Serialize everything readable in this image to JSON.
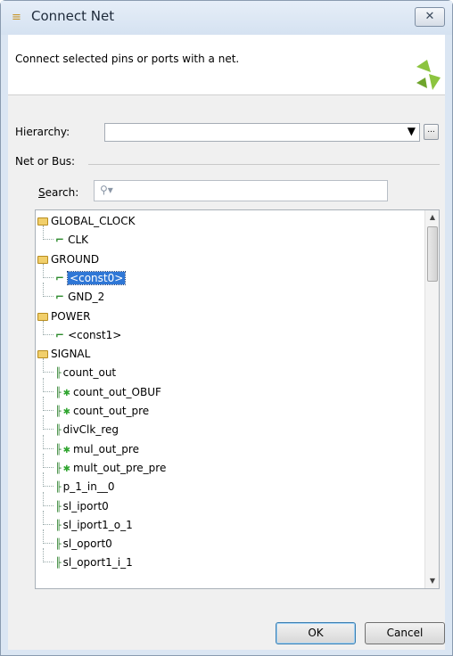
{
  "window": {
    "title": "Connect Net",
    "close_glyph": "✕"
  },
  "header": {
    "description": "Connect selected pins or ports with a net."
  },
  "hierarchy": {
    "label": "Hierarchy:",
    "value": "",
    "more_label": "..."
  },
  "net_or_bus": {
    "label": "Net or Bus:"
  },
  "search": {
    "label_prefix": "S",
    "label_rest": "earch:",
    "value": ""
  },
  "tree": [
    {
      "kind": "group",
      "label": "GLOBAL_CLOCK"
    },
    {
      "kind": "net",
      "label": "CLK"
    },
    {
      "kind": "group",
      "label": "GROUND"
    },
    {
      "kind": "net",
      "label": "<const0>",
      "selected": true
    },
    {
      "kind": "net",
      "label": "GND_2"
    },
    {
      "kind": "group",
      "label": "POWER"
    },
    {
      "kind": "net",
      "label": "<const1>"
    },
    {
      "kind": "group",
      "label": "SIGNAL"
    },
    {
      "kind": "bus",
      "label": "count_out"
    },
    {
      "kind": "bus",
      "label": "count_out_OBUF",
      "star": true
    },
    {
      "kind": "bus",
      "label": "count_out_pre",
      "star": true
    },
    {
      "kind": "bus",
      "label": "divClk_reg"
    },
    {
      "kind": "bus",
      "label": "mul_out_pre",
      "star": true
    },
    {
      "kind": "bus",
      "label": "mult_out_pre_pre",
      "star": true
    },
    {
      "kind": "bus",
      "label": "p_1_in__0"
    },
    {
      "kind": "bus",
      "label": "sl_iport0"
    },
    {
      "kind": "bus",
      "label": "sl_iport1_o_1"
    },
    {
      "kind": "bus",
      "label": "sl_oport0"
    },
    {
      "kind": "bus",
      "label": "sl_oport1_i_1"
    }
  ],
  "buttons": {
    "ok": "OK",
    "cancel": "Cancel"
  },
  "colors": {
    "accent": "#2f77d6",
    "logo": "#8cc43f"
  }
}
